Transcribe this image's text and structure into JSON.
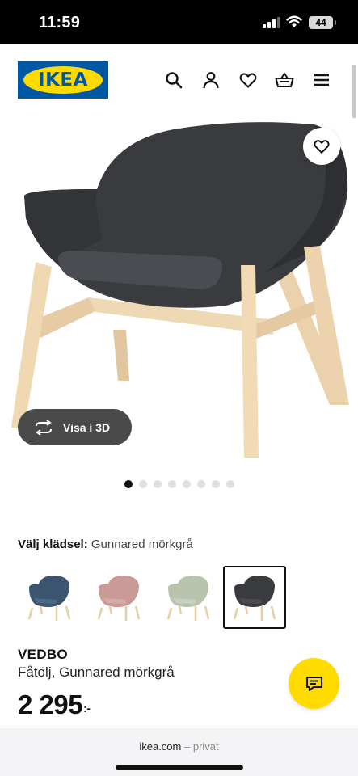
{
  "status_bar": {
    "time": "11:59",
    "battery": "44"
  },
  "header": {
    "logo": "IKEA",
    "icons": [
      "search-icon",
      "profile-icon",
      "heart-icon",
      "basket-icon",
      "menu-icon"
    ]
  },
  "gallery": {
    "view_3d_label": "Visa i 3D",
    "image_count": 8,
    "active_index": 0
  },
  "fabric": {
    "label": "Välj klädsel:",
    "value": "Gunnared mörkgrå",
    "swatches": [
      {
        "color": "#3b5470"
      },
      {
        "color": "#c99a96"
      },
      {
        "color": "#b9c3ae"
      },
      {
        "color": "#3a3b3e",
        "selected": true
      }
    ]
  },
  "product": {
    "name": "VEDBO",
    "description": "Fåtölj, Gunnared mörkgrå",
    "price": "2 295",
    "price_suffix": ":-"
  },
  "browser": {
    "domain": "ikea.com",
    "separator": "–",
    "mode": "privat"
  },
  "colors": {
    "brand_blue": "#0058a3",
    "brand_yellow": "#ffdb00"
  }
}
